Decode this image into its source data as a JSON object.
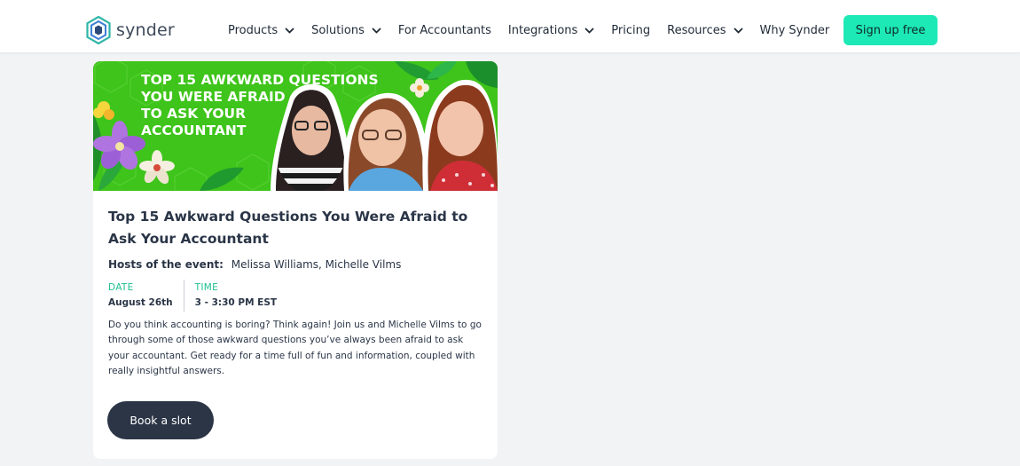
{
  "header": {
    "logo": {
      "text": "synder",
      "icon": "synder-hexagon-logo"
    },
    "nav": [
      {
        "label": "Products",
        "has_dropdown": true
      },
      {
        "label": "Solutions",
        "has_dropdown": true
      },
      {
        "label": "For Accountants",
        "has_dropdown": false
      },
      {
        "label": "Integrations",
        "has_dropdown": true
      },
      {
        "label": "Pricing",
        "has_dropdown": false
      },
      {
        "label": "Resources",
        "has_dropdown": true
      },
      {
        "label": "Why Synder",
        "has_dropdown": false
      }
    ],
    "signup_label": "Sign up free"
  },
  "event": {
    "banner": {
      "headline_lines": [
        "TOP 15 AWKWARD QUESTIONS",
        "YOU WERE AFRAID",
        "TO ASK YOUR",
        "ACCOUNTANT"
      ]
    },
    "title": "Top 15 Awkward Questions You Were Afraid to Ask Your Accountant",
    "hosts_label": "Hosts of the event:",
    "hosts": "Melissa Williams, Michelle Vilms",
    "date_label": "DATE",
    "date_value": "August 26th",
    "time_label": "TIME",
    "time_value": "3 - 3:30 PM EST",
    "description": "Do you think accounting is boring? Think again! Join us and Michelle Vilms to go through some of those awkward questions you’ve always been afraid to ask your accountant. Get ready for a time full of fun and information, coupled with really insightful answers.",
    "book_label": "Book a slot"
  },
  "colors": {
    "accent": "#1de9b6",
    "meta_label": "#1fbf8f",
    "dark_button": "#2b3546",
    "banner_green": "#3ec41a",
    "page_bg": "#f1f3f5"
  }
}
